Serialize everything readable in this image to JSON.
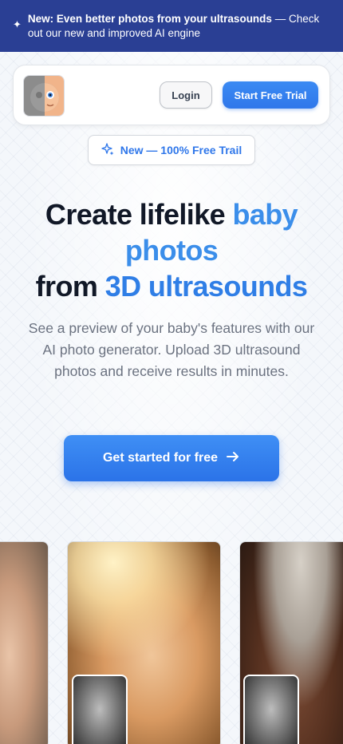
{
  "banner": {
    "icon": "sparkle-icon",
    "bold_text": "New: Even better photos from your ultrasounds",
    "rest_text": " — Check out our new and improved AI engine"
  },
  "nav": {
    "logo": "baby-face-logo",
    "login_label": "Login",
    "trial_label": "Start Free Trial",
    "accent_color": "#2f77ea"
  },
  "pill": {
    "icon": "sparkles-icon",
    "label": "New — 100% Free Trail"
  },
  "hero": {
    "line1_plain": "Create lifelike ",
    "line1_accent": "baby",
    "line2_accent": "photos",
    "line3_plain": "from ",
    "line3_accent": "3D ultrasounds"
  },
  "subtitle": "See a preview of your baby's features with our AI photo generator. Upload 3D ultrasound photos and receive results in minutes.",
  "cta": {
    "label": "Get started for free",
    "icon": "arrow-right-icon"
  },
  "gallery": [
    {
      "name": "sleeping-baby-photo"
    },
    {
      "name": "baby-sunlight-photo",
      "thumbnail": "ultrasound-thumbnail"
    },
    {
      "name": "baby-headband-photo",
      "thumbnail": "ultrasound-thumbnail"
    }
  ]
}
